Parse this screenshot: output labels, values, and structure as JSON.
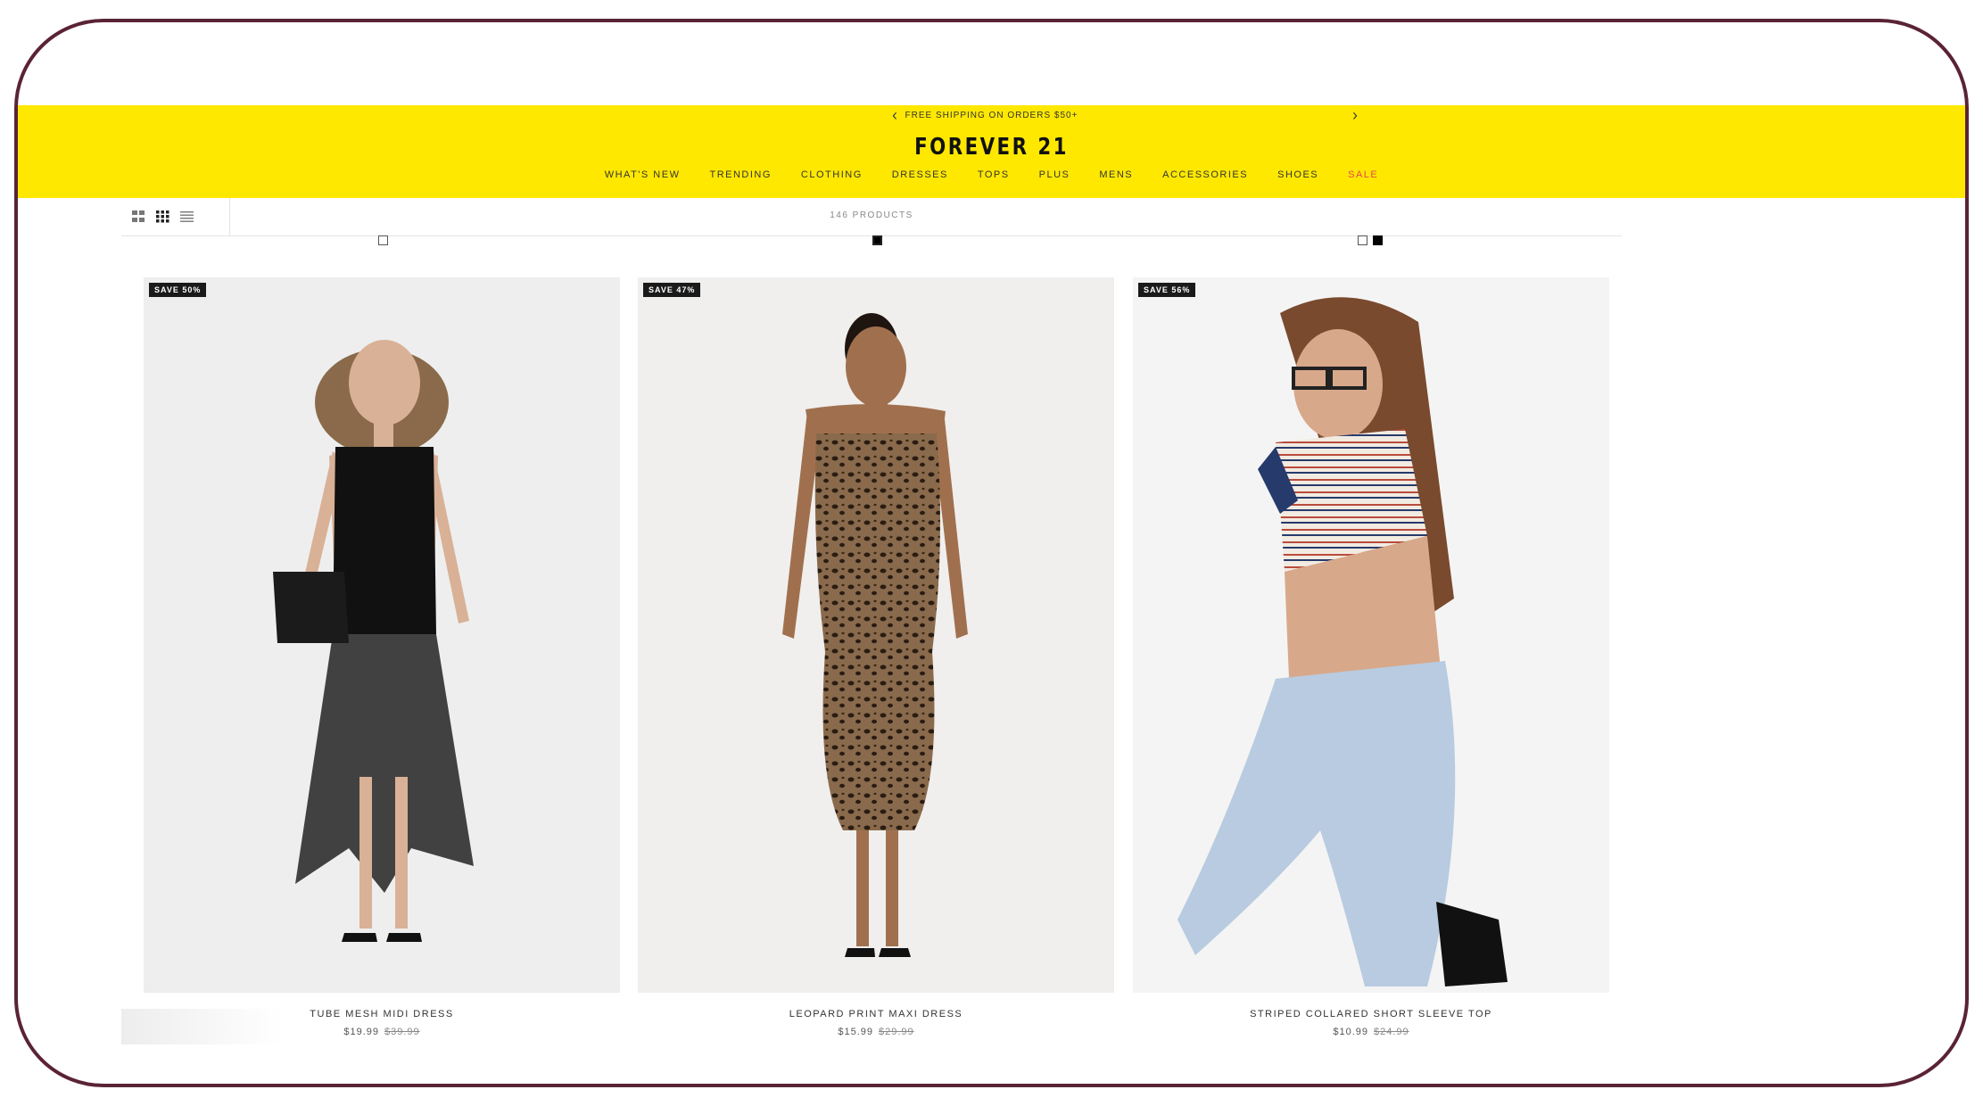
{
  "promo": {
    "text": "FREE SHIPPING ON ORDERS $50+",
    "prev_icon": "chevron-left-icon",
    "next_icon": "chevron-right-icon"
  },
  "brand": {
    "name": "FOREVER 21",
    "header_color": "#ffe800",
    "sale_color": "#e5484d"
  },
  "nav": {
    "whats_new": "WHAT'S NEW",
    "trending": "TRENDING",
    "clothing": "CLOTHING",
    "dresses": "DRESSES",
    "tops": "TOPS",
    "plus": "PLUS",
    "mens": "MENS",
    "accessories": "ACCESSORIES",
    "shoes": "SHOES",
    "sale": "SALE"
  },
  "toolbar": {
    "product_count": "146 PRODUCTS",
    "view_icons": [
      "grid-large-icon",
      "grid-small-icon",
      "list-view-icon"
    ]
  },
  "products": [
    {
      "badge": "SAVE 50%",
      "name": "TUBE MESH MIDI DRESS",
      "price": "$19.99",
      "original_price": "$39.99",
      "image": "black-dress-photo"
    },
    {
      "badge": "SAVE 47%",
      "name": "LEOPARD PRINT MAXI DRESS",
      "price": "$15.99",
      "original_price": "$29.99",
      "image": "leopard-dress-photo"
    },
    {
      "badge": "SAVE 56%",
      "name": "STRIPED COLLARED SHORT SLEEVE TOP",
      "price": "$10.99",
      "original_price": "$24.99",
      "image": "striped-top-photo"
    }
  ]
}
